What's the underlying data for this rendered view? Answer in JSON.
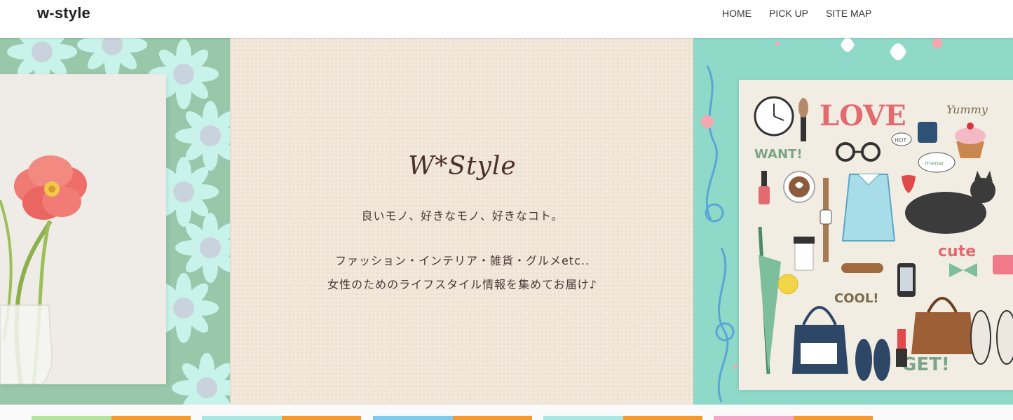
{
  "header": {
    "logo": "w-style",
    "nav": [
      {
        "label": "HOME"
      },
      {
        "label": "PICK UP"
      },
      {
        "label": "SITE MAP"
      }
    ]
  },
  "hero": {
    "brand": "W*Style",
    "tagline_1": "良いモノ、好きなモノ、好きなコト。",
    "tagline_2": "ファッション・インテリア・雑貨・グルメetc..",
    "tagline_3": "女性のためのライフスタイル情報を集めてお届け♪",
    "illustration_words": [
      "LOVE",
      "Yummy",
      "WANT!",
      "cute",
      "COOL!",
      "GET!",
      "HOT",
      "meow"
    ]
  },
  "colors": {
    "left_bg": "#8fcfa8",
    "center_bg": "#efe4d6",
    "right_bg": "#8fd9c9",
    "brand_text": "#4a2e2a"
  },
  "thumbnails": [
    {
      "name": "thumb-1",
      "colors": [
        "#b6e3a0",
        "#f29a2e"
      ]
    },
    {
      "name": "thumb-2",
      "colors": [
        "#a8e8e4",
        "#f29a2e"
      ]
    },
    {
      "name": "thumb-3",
      "colors": [
        "#7fc8ee",
        "#f29a2e"
      ]
    },
    {
      "name": "thumb-4",
      "colors": [
        "#a8e8e4",
        "#f29a2e"
      ]
    },
    {
      "name": "thumb-5",
      "colors": [
        "#f7a6c7",
        "#f29a2e"
      ]
    }
  ]
}
